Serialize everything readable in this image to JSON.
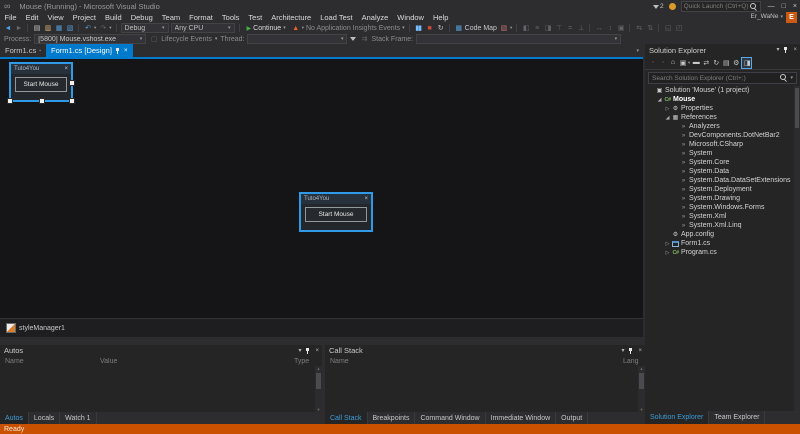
{
  "colors": {
    "accent": "#007ACC",
    "status_bar_debug": "#CA5100",
    "selection_border": "#2F9BE8",
    "chrome": "#2D2D30",
    "panel": "#252526"
  },
  "glyphs": {
    "caret": "▾",
    "close": "×",
    "minimize": "—",
    "restore": "□",
    "play": "▶",
    "tab_dot": "▪",
    "overflow": "▾",
    "logo": "∞"
  },
  "window": {
    "title": "Mouse (Running) - Microsoft Visual Studio",
    "notifications_count": "2",
    "quick_launch_placeholder": "Quick Launch (Ctrl+Q)",
    "user_name": "Er_WaNe",
    "avatar_letter": "E"
  },
  "menu_items": [
    "File",
    "Edit",
    "View",
    "Project",
    "Build",
    "Debug",
    "Team",
    "Format",
    "Tools",
    "Test",
    "Architecture",
    "Load Test",
    "Analyze",
    "Window",
    "Help"
  ],
  "toolbar": {
    "left_icons": [
      {
        "name": "navigate-backward-icon",
        "glyph": "◄",
        "color": "#4BA0E8"
      },
      {
        "name": "navigate-forward-icon",
        "glyph": "►",
        "color": "#64646A"
      },
      {
        "sep": true
      },
      {
        "name": "new-file-icon",
        "glyph": "▤",
        "color": "#C8C8C8"
      },
      {
        "name": "open-file-icon",
        "glyph": "▥",
        "color": "#DCB67A"
      },
      {
        "name": "save-icon",
        "glyph": "▦",
        "color": "#569CD6"
      },
      {
        "name": "save-all-icon",
        "glyph": "▧",
        "color": "#569CD6"
      },
      {
        "sep": true
      },
      {
        "name": "undo-icon",
        "glyph": "↶",
        "color": "#569CD6",
        "caret": true
      },
      {
        "name": "redo-icon",
        "glyph": "↷",
        "color": "#64646A",
        "caret": true
      },
      {
        "sep": true
      }
    ],
    "debug_target_label": "Debug",
    "platform_label": "Any CPU",
    "continue_label": "Continue",
    "insights_icons": [
      {
        "name": "application-insights-icon",
        "glyph": "▲",
        "color": "#E8622C",
        "caret": true
      }
    ],
    "insights_label": "No Application Insights Events",
    "debug_control_icons": [
      {
        "name": "pause-icon",
        "glyph": "▮▮",
        "color": "#75BEFF"
      },
      {
        "name": "stop-icon",
        "glyph": "■",
        "color": "#D04A3A"
      },
      {
        "name": "restart-icon",
        "glyph": "↻",
        "color": "#C8C8C8"
      },
      {
        "sep": true
      }
    ],
    "codemap_icons": [
      {
        "name": "code-map-icon",
        "glyph": "▦",
        "color": "#56A0D6"
      }
    ],
    "codemap_label": "Code Map",
    "after_codemap_icons": [
      {
        "name": "work-item-icon",
        "glyph": "▧",
        "color": "#C27070",
        "caret": true
      },
      {
        "sep": true
      },
      {
        "name": "align-lefts-icon",
        "glyph": "◧",
        "dim": true
      },
      {
        "name": "align-centers-icon",
        "glyph": "≡",
        "dim": true
      },
      {
        "name": "align-rights-icon",
        "glyph": "◨",
        "dim": true
      },
      {
        "name": "align-tops-icon",
        "glyph": "⊤",
        "dim": true
      },
      {
        "name": "align-middles-icon",
        "glyph": "=",
        "dim": true
      },
      {
        "name": "align-bottoms-icon",
        "glyph": "⊥",
        "dim": true
      },
      {
        "sep": true
      },
      {
        "name": "make-same-width-icon",
        "glyph": "↔",
        "dim": true
      },
      {
        "name": "make-same-height-icon",
        "glyph": "↕",
        "dim": true
      },
      {
        "name": "make-same-size-icon",
        "glyph": "▣",
        "dim": true
      },
      {
        "sep": true
      },
      {
        "name": "equal-horizontal-spacing-icon",
        "glyph": "⇆",
        "dim": true
      },
      {
        "name": "equal-vertical-spacing-icon",
        "glyph": "⇅",
        "dim": true
      },
      {
        "sep": true
      },
      {
        "name": "bring-to-front-icon",
        "glyph": "◱",
        "dim": true
      },
      {
        "name": "send-to-back-icon",
        "glyph": "◰",
        "dim": true
      }
    ]
  },
  "debug_location_bar": {
    "process_label": "Process:",
    "process_value": "[5800] Mouse.vshost.exe",
    "lifecycle_icons": [
      {
        "name": "lifecycle-events-icon",
        "glyph": "▢",
        "dim": true
      }
    ],
    "lifecycle_label": "Lifecycle Events",
    "thread_label": "Thread:",
    "thread_value": "",
    "filter_icons": [
      {
        "name": "flag-threads-icon",
        "glyph": "⇉",
        "dim": true
      }
    ],
    "stack_frame_label": "Stack Frame:",
    "stack_frame_value": ""
  },
  "document_tabs": [
    {
      "label": "Form1.cs",
      "active": false
    },
    {
      "label": "Form1.cs [Design]",
      "active": true
    }
  ],
  "designer": {
    "form_title": "Tuto4You",
    "button_label": "Start Mouse",
    "tray_component": "styleManager1"
  },
  "autos_panel": {
    "title": "Autos",
    "columns": [
      "Name",
      "Value",
      "Type"
    ],
    "tabs": [
      {
        "label": "Autos",
        "active": true
      },
      {
        "label": "Locals",
        "active": false
      },
      {
        "label": "Watch 1",
        "active": false
      }
    ]
  },
  "callstack_panel": {
    "title": "Call Stack",
    "columns": [
      "Name",
      "Lang"
    ],
    "tabs": [
      {
        "label": "Call Stack",
        "active": true
      },
      {
        "label": "Breakpoints",
        "active": false
      },
      {
        "label": "Command Window",
        "active": false
      },
      {
        "label": "Immediate Window",
        "active": false
      },
      {
        "label": "Output",
        "active": false
      }
    ]
  },
  "solution_explorer": {
    "title": "Solution Explorer",
    "search_placeholder": "Search Solution Explorer (Ctrl+;)",
    "toolbar_icons": [
      {
        "name": "navigate-back-icon",
        "glyph": "◦",
        "dim": true
      },
      {
        "name": "navigate-forward-icon",
        "glyph": "◦",
        "dim": true
      },
      {
        "name": "home-icon",
        "glyph": "⌂"
      },
      {
        "name": "scope-to-this-icon",
        "glyph": "▣",
        "caret": true
      },
      {
        "name": "collapse-all-icon",
        "glyph": "▬"
      },
      {
        "name": "sync-with-active-document-icon",
        "glyph": "⇄"
      },
      {
        "name": "refresh-icon",
        "glyph": "↻"
      },
      {
        "name": "show-all-files-icon",
        "glyph": "▤"
      },
      {
        "name": "properties-icon",
        "glyph": "⚙"
      },
      {
        "name": "preview-selected-items-icon",
        "glyph": "◨",
        "hl": true
      }
    ],
    "tree": [
      {
        "label": "Solution 'Mouse' (1 project)",
        "level": 0,
        "icon": "solution",
        "expander": "none"
      },
      {
        "label": "Mouse",
        "level": 1,
        "icon": "csproject",
        "expander": "expanded",
        "bold": true
      },
      {
        "label": "Properties",
        "level": 2,
        "icon": "properties",
        "expander": "collapsed"
      },
      {
        "label": "References",
        "level": 2,
        "icon": "references",
        "expander": "expanded"
      },
      {
        "label": "Analyzers",
        "level": 3,
        "icon": "reference",
        "expander": "none"
      },
      {
        "label": "DevComponents.DotNetBar2",
        "level": 3,
        "icon": "reference",
        "expander": "none"
      },
      {
        "label": "Microsoft.CSharp",
        "level": 3,
        "icon": "reference",
        "expander": "none"
      },
      {
        "label": "System",
        "level": 3,
        "icon": "reference",
        "expander": "none"
      },
      {
        "label": "System.Core",
        "level": 3,
        "icon": "reference",
        "expander": "none"
      },
      {
        "label": "System.Data",
        "level": 3,
        "icon": "reference",
        "expander": "none"
      },
      {
        "label": "System.Data.DataSetExtensions",
        "level": 3,
        "icon": "reference",
        "expander": "none"
      },
      {
        "label": "System.Deployment",
        "level": 3,
        "icon": "reference",
        "expander": "none"
      },
      {
        "label": "System.Drawing",
        "level": 3,
        "icon": "reference",
        "expander": "none"
      },
      {
        "label": "System.Windows.Forms",
        "level": 3,
        "icon": "reference",
        "expander": "none"
      },
      {
        "label": "System.Xml",
        "level": 3,
        "icon": "reference",
        "expander": "none"
      },
      {
        "label": "System.Xml.Linq",
        "level": 3,
        "icon": "reference",
        "expander": "none"
      },
      {
        "label": "App.config",
        "level": 2,
        "icon": "config",
        "expander": "none"
      },
      {
        "label": "Form1.cs",
        "level": 2,
        "icon": "form",
        "expander": "collapsed"
      },
      {
        "label": "Program.cs",
        "level": 2,
        "icon": "csfile",
        "expander": "collapsed"
      }
    ],
    "bottom_tabs": [
      {
        "label": "Solution Explorer",
        "active": true
      },
      {
        "label": "Team Explorer",
        "active": false
      }
    ]
  },
  "status_bar": {
    "text": "Ready"
  }
}
